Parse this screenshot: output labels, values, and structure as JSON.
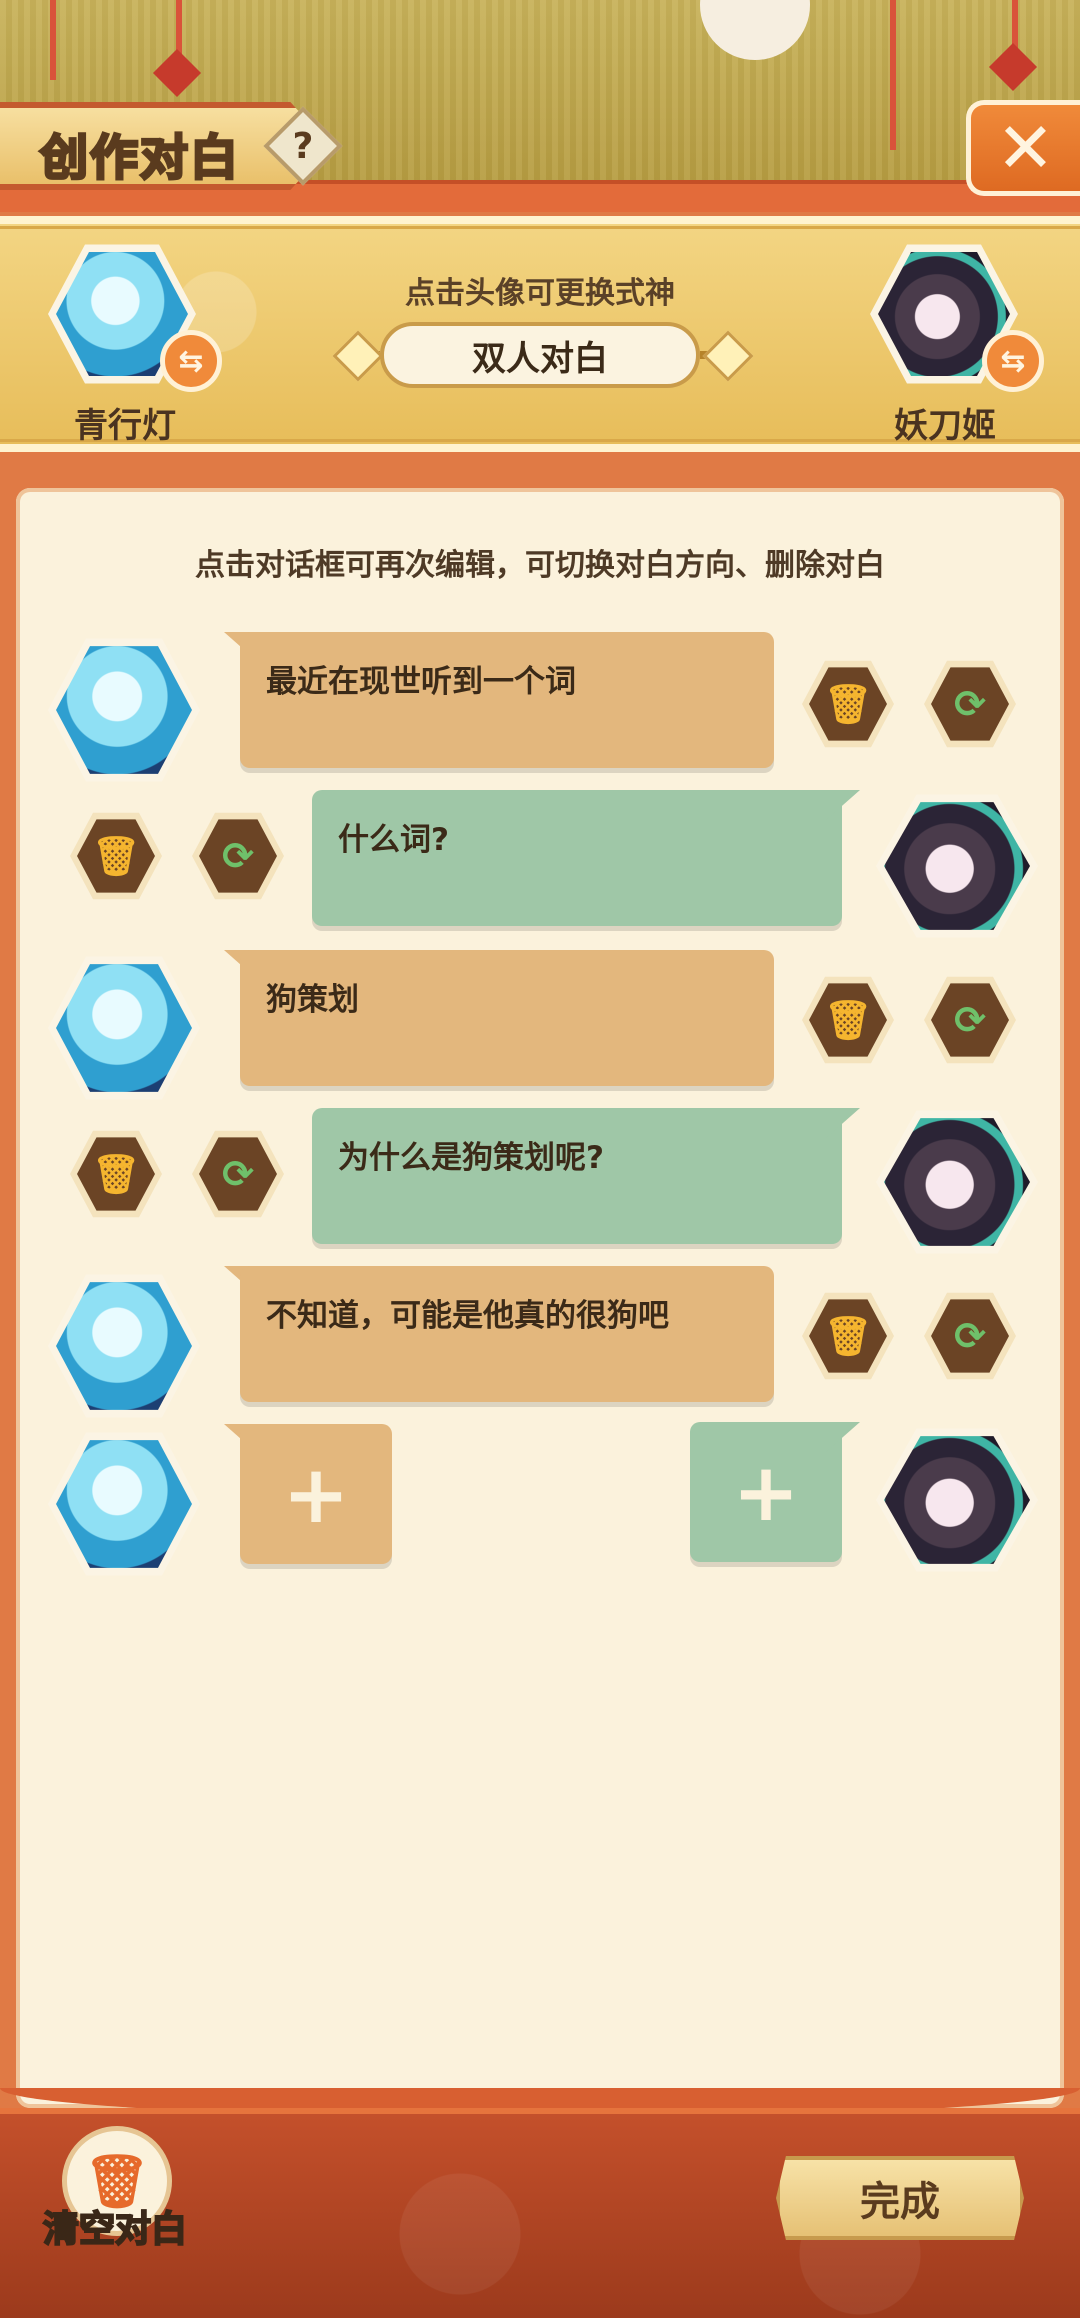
{
  "header": {
    "title": "创作对白",
    "help_symbol": "?",
    "close_symbol": "✕"
  },
  "selection": {
    "hint": "点击头像可更换式神",
    "mode": "双人对白",
    "left_character": {
      "name": "青行灯",
      "icon": "qingxingdeng-avatar-icon"
    },
    "right_character": {
      "name": "妖刀姬",
      "icon": "yaodaoji-avatar-icon"
    },
    "swap_symbol": "⇆"
  },
  "panel": {
    "hint": "点击对话框可再次编辑，可切换对白方向、删除对白"
  },
  "dialogues": [
    {
      "text": "最近在现世听到一个词"
    },
    {
      "text": "什么词?"
    },
    {
      "text": "狗策划"
    },
    {
      "text": "为什么是狗策划呢?"
    },
    {
      "text": "不知道，可能是他真的很狗吧"
    }
  ],
  "buttons": {
    "delete_symbol": "🗑",
    "swap_symbol": "⟳",
    "add_symbol": "+",
    "clear_label": "清空对白",
    "clear_symbol": "🗑",
    "done_label": "完成"
  },
  "colors": {
    "left_bubble": "#e3b77d",
    "right_bubble": "#9fc7a7",
    "panel_bg": "#fbf2dc",
    "accent": "#f08a3a"
  }
}
